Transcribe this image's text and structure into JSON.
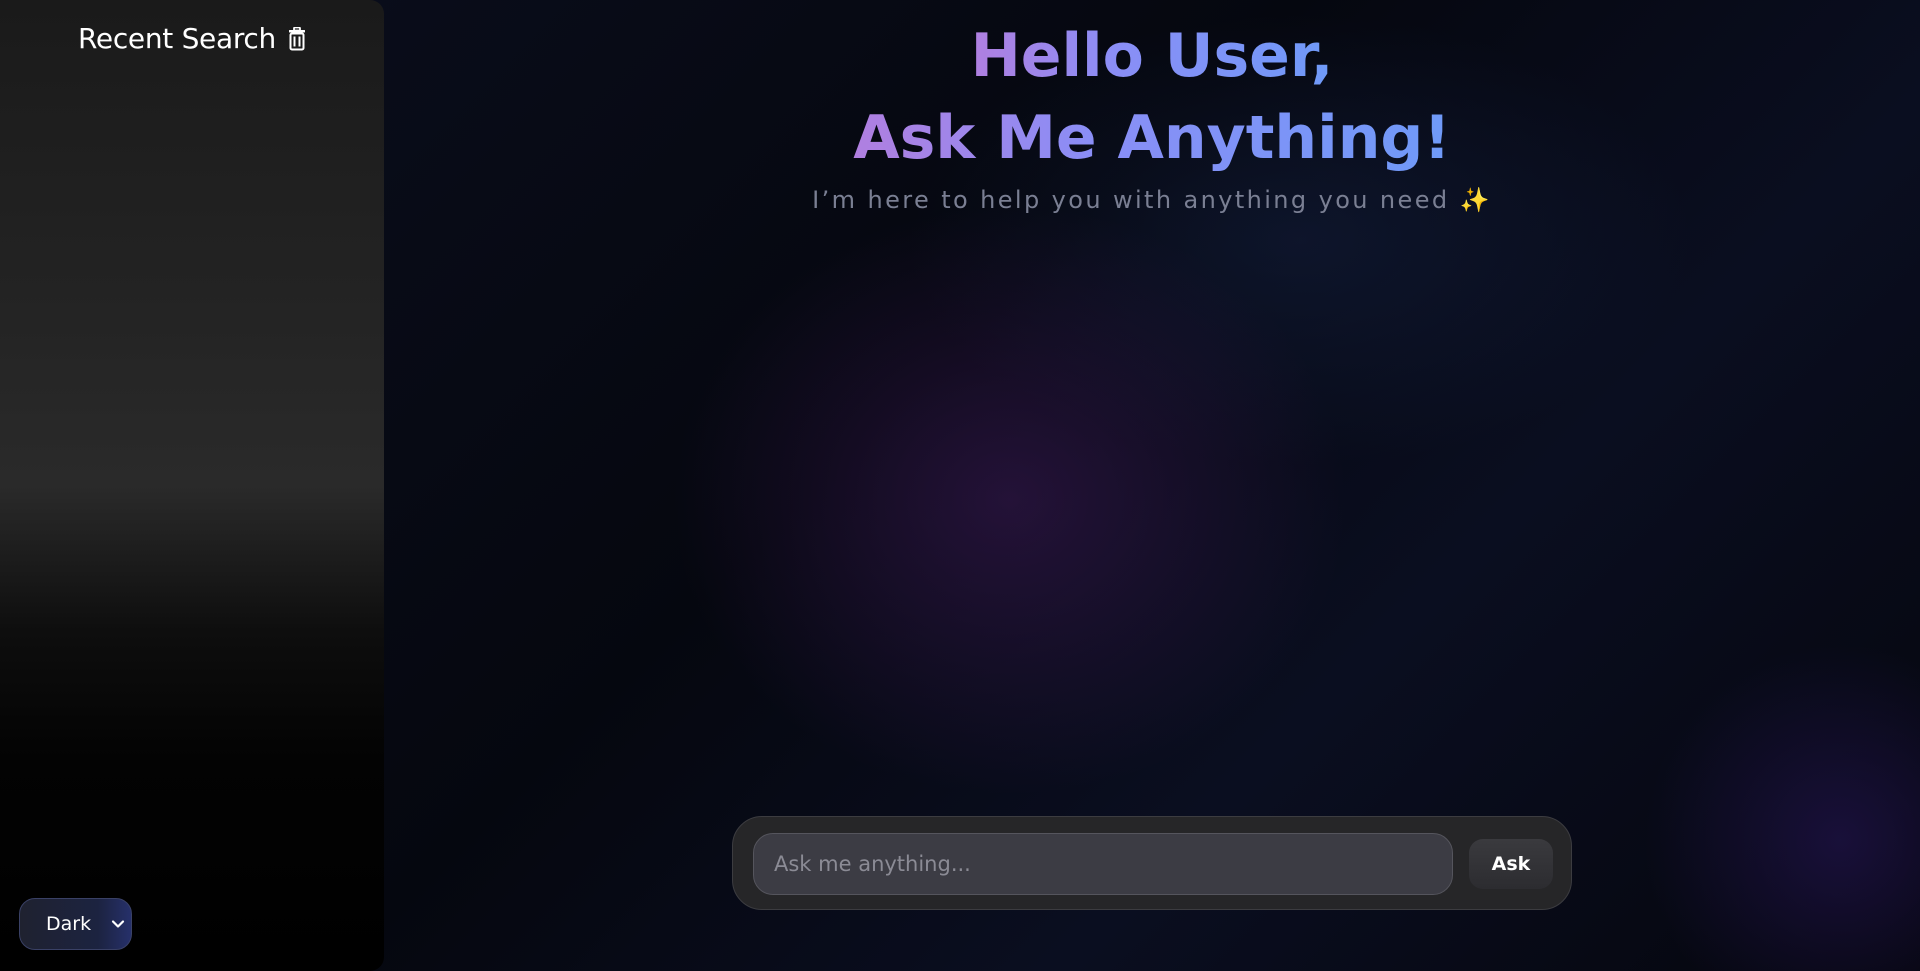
{
  "sidebar": {
    "title": "Recent Search",
    "clear_icon": "trash-icon",
    "theme_select": {
      "value": "Dark",
      "chevron_icon": "chevron-down-icon"
    }
  },
  "hero": {
    "line1": "Hello User,",
    "line2": "Ask Me Anything!",
    "subtitle": "I’m here to help you with anything you need ✨"
  },
  "ask": {
    "placeholder": "Ask me anything...",
    "button_label": "Ask"
  },
  "colors": {
    "gradient_start": "#b07fe0",
    "gradient_end": "#6f9af8",
    "subtitle": "#7a7f93"
  }
}
